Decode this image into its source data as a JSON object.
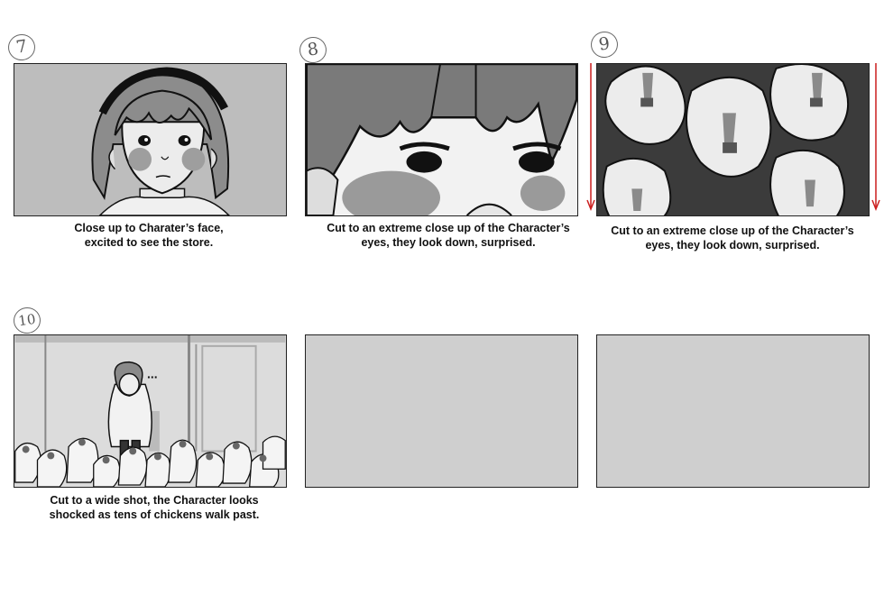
{
  "panels": [
    {
      "number": "7",
      "caption_lines": [
        "Close up to Charater’s face,",
        "excited to see the store."
      ]
    },
    {
      "number": "8",
      "caption_lines": [
        "Cut to an extreme close up of the Character’s",
        "eyes, they look down, surprised."
      ]
    },
    {
      "number": "9",
      "caption_lines": [
        "Cut to an extreme close up of the Character’s",
        "eyes, they look down, surprised."
      ]
    },
    {
      "number": "10",
      "speech_text": "...",
      "caption_lines": [
        "Cut to a wide shot, the Character looks",
        "shocked as tens of chickens walk past."
      ]
    },
    {
      "number": "",
      "caption_lines": []
    },
    {
      "number": "",
      "caption_lines": []
    }
  ],
  "colors": {
    "panel_blank": "#cfcfcf",
    "arrow": "#cc1f1f",
    "line_art": "#111111"
  }
}
